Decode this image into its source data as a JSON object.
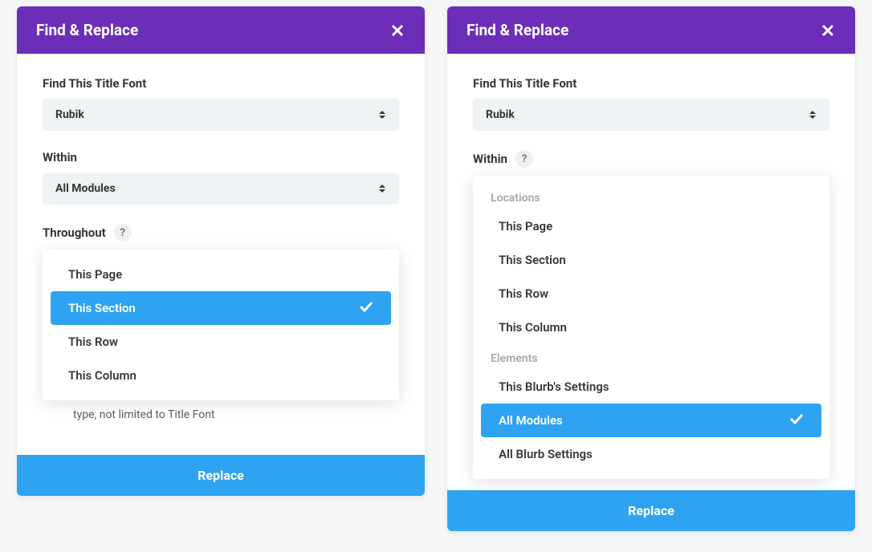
{
  "left": {
    "title": "Find & Replace",
    "findLabel": "Find This Title Font",
    "findValue": "Rubik",
    "withinLabel": "Within",
    "withinValue": "All Modules",
    "throughoutLabel": "Throughout",
    "help": "?",
    "options": [
      "This Page",
      "This Section",
      "This Row",
      "This Column"
    ],
    "selected": "This Section",
    "noteLine": "type, not limited to Title Font",
    "replaceLabel": "Replace"
  },
  "right": {
    "title": "Find & Replace",
    "findLabel": "Find This Title Font",
    "findValue": "Rubik",
    "withinLabel": "Within",
    "help": "?",
    "groups": [
      {
        "label": "Locations",
        "items": [
          "This Page",
          "This Section",
          "This Row",
          "This Column"
        ]
      },
      {
        "label": "Elements",
        "items": [
          "This Blurb's Settings",
          "All Modules",
          "All Blurb Settings"
        ]
      }
    ],
    "selected": "All Modules",
    "replaceLabel": "Replace"
  }
}
